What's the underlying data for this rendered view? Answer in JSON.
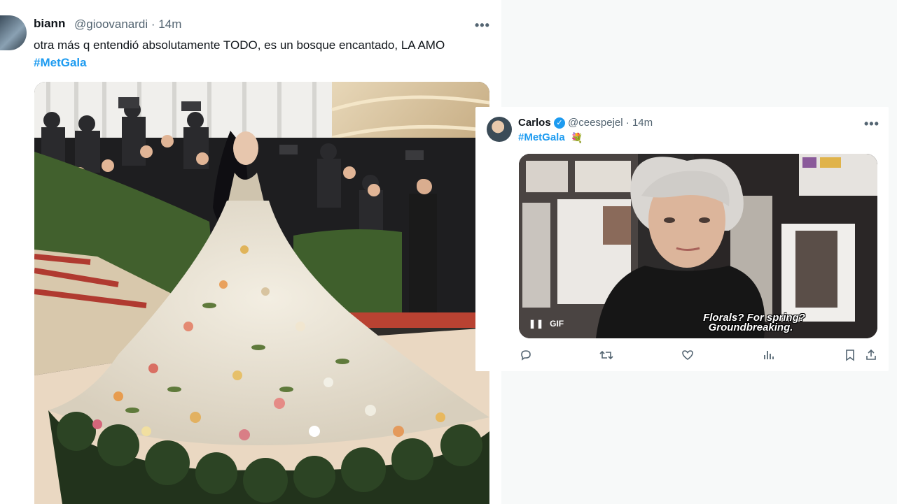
{
  "tweet1": {
    "display_name": "biann",
    "handle": "@gioovanardi",
    "separator": "·",
    "time": "14m",
    "more": "•••",
    "text": "otra más q entendió absolutamente TODO, es un bosque encantado, LA AMO ",
    "hashtag": "#MetGala"
  },
  "tweet2": {
    "display_name": "Carlos",
    "handle": "@ceespejel",
    "separator": "·",
    "time": "14m",
    "more": "•••",
    "hashtag": "#MetGala",
    "emoji": "💐",
    "gif": {
      "badge": "GIF",
      "caption_line1": "Florals? For spring?",
      "caption_line2": "Groundbreaking."
    },
    "actions": [
      "reply-icon",
      "retweet-icon",
      "like-icon",
      "views-icon",
      "bookmark-icon",
      "share-icon"
    ]
  },
  "colors": {
    "accent": "#1d9bf0",
    "text": "#0f1419",
    "secondary": "#536471",
    "page_bg": "#f7f9f9"
  }
}
